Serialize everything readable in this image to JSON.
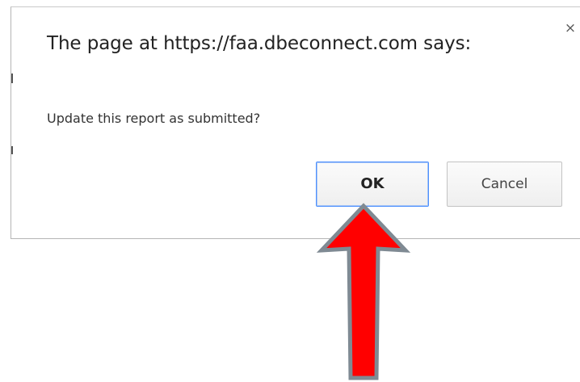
{
  "dialog": {
    "title": "The page at https://faa.dbeconnect.com says:",
    "message": "Update this report as submitted?",
    "close_label": "×",
    "ok_label": "OK",
    "cancel_label": "Cancel"
  },
  "annotation": {
    "arrow_color": "#ff0000",
    "arrow_outline_color": "#7f8a93",
    "points_to": "ok-button"
  }
}
